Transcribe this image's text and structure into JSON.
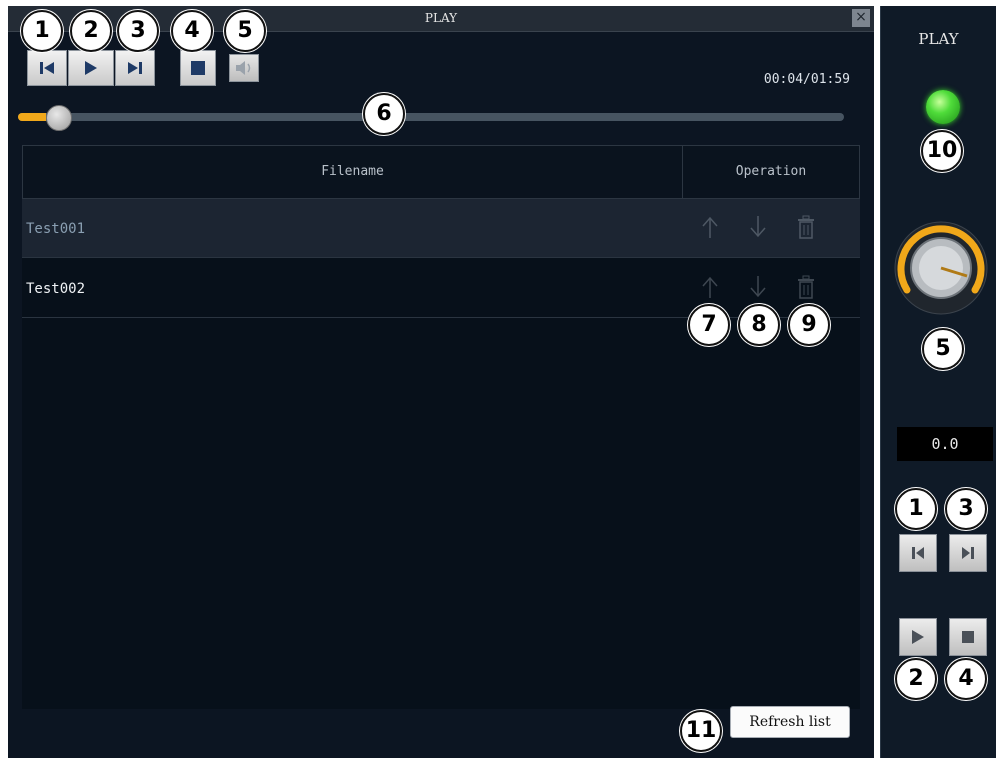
{
  "window": {
    "title": "PLAY",
    "close_glyph": "×"
  },
  "toolbar": {
    "prev_icon": "skip-back-icon",
    "play_icon": "play-icon",
    "next_icon": "skip-forward-icon",
    "stop_icon": "stop-icon",
    "volume_icon": "volume-icon"
  },
  "playback": {
    "time": "00:04/01:59",
    "progress_fraction": 0.034
  },
  "table": {
    "columns": [
      "Filename",
      "Operation"
    ],
    "rows": [
      {
        "filename": "Test001",
        "selected": true
      },
      {
        "filename": "Test002",
        "selected": false
      }
    ],
    "operation_icons": [
      "arrow-up-icon",
      "arrow-down-icon",
      "trash-icon"
    ]
  },
  "refresh_button": {
    "label": "Refresh list"
  },
  "side_panel": {
    "title": "PLAY",
    "status_led_color": "#4fdc3a",
    "readout": "0.0",
    "knob_accent_color": "#f1a81a"
  },
  "callouts": {
    "c1": "1",
    "c2": "2",
    "c3": "3",
    "c4": "4",
    "c5": "5",
    "c6": "6",
    "c7": "7",
    "c8": "8",
    "c9": "9",
    "c10": "10",
    "c11": "11"
  }
}
